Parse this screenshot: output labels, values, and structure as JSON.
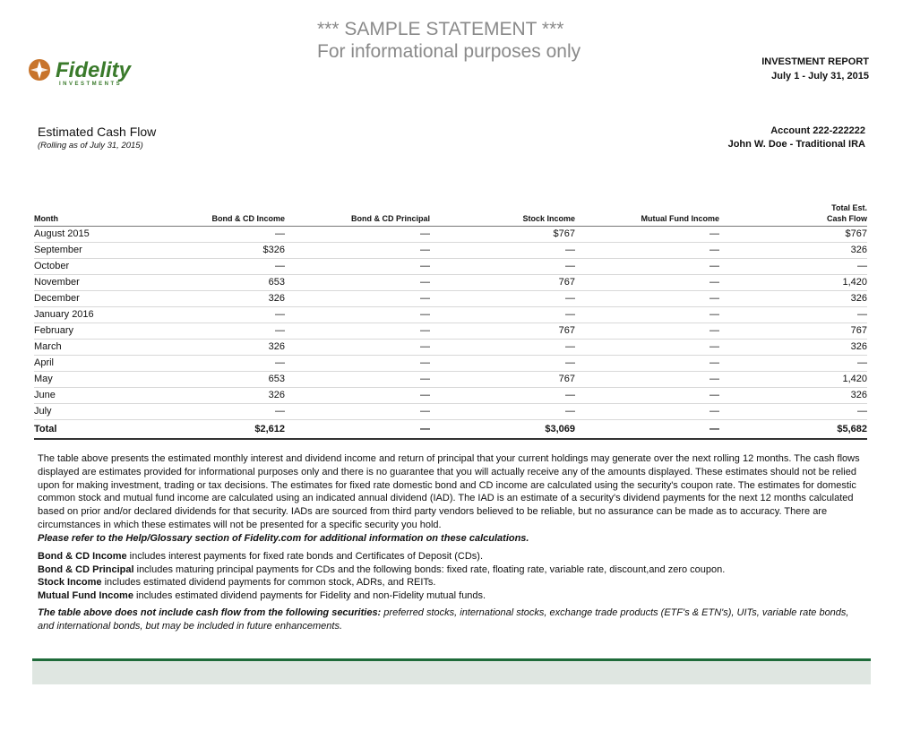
{
  "watermark": {
    "line1": "*** SAMPLE STATEMENT ***",
    "line2": "For informational purposes only"
  },
  "logo": {
    "text": "Fidelity",
    "subtext": "INVESTMENTS",
    "brand_color": "#3a7a2b",
    "accent_color": "#c8742b"
  },
  "report": {
    "title": "INVESTMENT REPORT",
    "period": "July 1 - July 31, 2015"
  },
  "section": {
    "title": "Estimated Cash Flow",
    "subtitle": "(Rolling as of July 31, 2015)"
  },
  "account": {
    "number": "Account 222-222222",
    "holder": "John W. Doe - Traditional IRA"
  },
  "table": {
    "columns": [
      "Month",
      "Bond & CD Income",
      "Bond & CD Principal",
      "Stock Income",
      "Mutual Fund Income",
      "Total Est.",
      "Cash Flow"
    ],
    "rows": [
      {
        "month": "August 2015",
        "bond_income": "—",
        "bond_principal": "—",
        "stock": "$767",
        "mutual": "—",
        "total": "$767"
      },
      {
        "month": "September",
        "bond_income": "$326",
        "bond_principal": "—",
        "stock": "—",
        "mutual": "—",
        "total": "326"
      },
      {
        "month": "October",
        "bond_income": "—",
        "bond_principal": "—",
        "stock": "—",
        "mutual": "—",
        "total": "—"
      },
      {
        "month": "November",
        "bond_income": "653",
        "bond_principal": "—",
        "stock": "767",
        "mutual": "—",
        "total": "1,420"
      },
      {
        "month": "December",
        "bond_income": "326",
        "bond_principal": "—",
        "stock": "—",
        "mutual": "—",
        "total": "326"
      },
      {
        "month": "January 2016",
        "bond_income": "—",
        "bond_principal": "—",
        "stock": "—",
        "mutual": "—",
        "total": "—"
      },
      {
        "month": "February",
        "bond_income": "—",
        "bond_principal": "—",
        "stock": "767",
        "mutual": "—",
        "total": "767"
      },
      {
        "month": "March",
        "bond_income": "326",
        "bond_principal": "—",
        "stock": "—",
        "mutual": "—",
        "total": "326"
      },
      {
        "month": "April",
        "bond_income": "—",
        "bond_principal": "—",
        "stock": "—",
        "mutual": "—",
        "total": "—"
      },
      {
        "month": "May",
        "bond_income": "653",
        "bond_principal": "—",
        "stock": "767",
        "mutual": "—",
        "total": "1,420"
      },
      {
        "month": "June",
        "bond_income": "326",
        "bond_principal": "—",
        "stock": "—",
        "mutual": "—",
        "total": "326"
      },
      {
        "month": "July",
        "bond_income": "—",
        "bond_principal": "—",
        "stock": "—",
        "mutual": "—",
        "total": "—"
      }
    ],
    "total": {
      "month": "Total",
      "bond_income": "$2,612",
      "bond_principal": "—",
      "stock": "$3,069",
      "mutual": "—",
      "total": "$5,682"
    }
  },
  "paragraph": {
    "body": "The table above presents the estimated monthly interest and dividend income and return of principal that your current holdings may generate over the next rolling 12 months. The cash flows displayed are estimates provided for informational purposes only and there is no guarantee that you will actually receive any of the amounts displayed. These estimates should not be relied upon for making investment, trading or tax decisions. The estimates for fixed rate domestic bond and CD income are calculated using the security's coupon rate. The estimates for domestic common stock and mutual fund income are calculated using an indicated annual dividend (IAD). The IAD is an estimate of a security's dividend payments for the next 12 months calculated based on prior and/or declared dividends for that security. IADs are sourced from third party vendors believed to be reliable, but no assurance can be made as to accuracy. There are circumstances in which these estimates will not be presented for a specific security you hold.",
    "note": "Please refer to the Help/Glossary section of Fidelity.com for additional information on these calculations."
  },
  "definitions": [
    {
      "term": "Bond & CD Income",
      "desc": " includes interest payments for fixed rate bonds and Certificates of Deposit (CDs)."
    },
    {
      "term": "Bond & CD Principal",
      "desc": " includes maturing principal payments for CDs and the following bonds: fixed rate, floating rate, variable rate, discount,and zero coupon."
    },
    {
      "term": "Stock Income",
      "desc": " includes estimated dividend payments for common stock, ADRs, and REITs."
    },
    {
      "term": "Mutual Fund Income",
      "desc": " includes estimated dividend payments for Fidelity and non-Fidelity mutual funds."
    }
  ],
  "exclusions": {
    "lead": "The table above does not include cash flow from the following securities:",
    "body": " preferred stocks, international stocks, exchange trade products (ETF's & ETN's), UITs, variable rate bonds, and international bonds, but may be included in future enhancements."
  }
}
